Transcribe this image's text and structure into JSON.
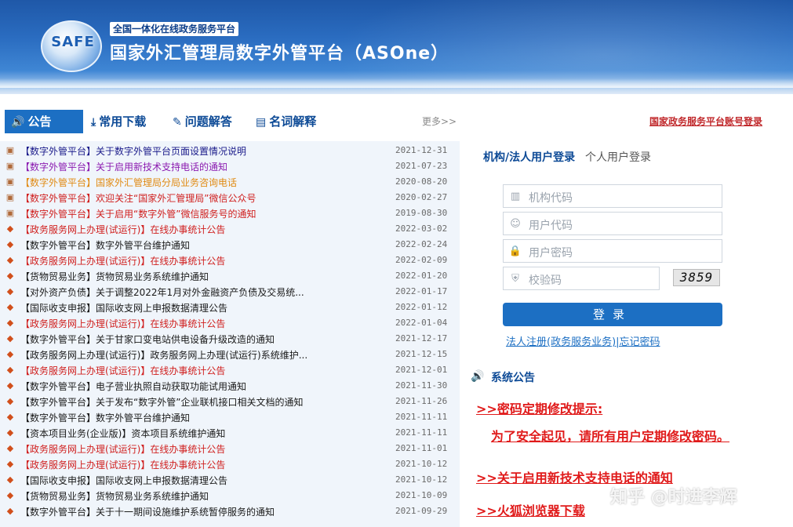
{
  "header": {
    "slogan": "全国一体化在线政务服务平台",
    "logo_text": "SAFE",
    "title": "国家外汇管理局数字外管平台（ASOne）"
  },
  "tabs": {
    "active": "公告",
    "items": [
      "常用下载",
      "问题解答",
      "名词解释"
    ],
    "more": "更多>>",
    "gov_login": "国家政务服务平台账号登录"
  },
  "notices": [
    {
      "tag": "【数字外管平台】",
      "title": "关于数字外管平台页面设置情况说明",
      "date": "2021-12-31",
      "color": "#1a1a8a",
      "icon": "doc-icon"
    },
    {
      "tag": "【数字外管平台】",
      "title": "关于启用新技术支持电话的通知",
      "date": "2021-07-23",
      "color": "#8b1bb0",
      "icon": "doc-icon"
    },
    {
      "tag": "【数字外管平台】",
      "title": "国家外汇管理局分局业务咨询电话",
      "date": "2020-08-20",
      "color": "#e08a12",
      "icon": "doc-icon"
    },
    {
      "tag": "【数字外管平台】",
      "title": "欢迎关注“国家外汇管理局”微信公众号",
      "date": "2020-02-27",
      "color": "#d0201f",
      "icon": "doc-icon"
    },
    {
      "tag": "【数字外管平台】",
      "title": "关于启用“数字外管”微信服务号的通知",
      "date": "2019-08-30",
      "color": "#d0201f",
      "icon": "doc-icon"
    },
    {
      "tag": "【政务服务网上办理(试运行)】",
      "title": "在线办事统计公告",
      "date": "2022-03-02",
      "color": "#d0201f",
      "icon": "diamond-icon"
    },
    {
      "tag": "【数字外管平台】",
      "title": "数字外管平台维护通知",
      "date": "2022-02-24",
      "color": "#1a1a1a",
      "icon": "diamond-icon"
    },
    {
      "tag": "【政务服务网上办理(试运行)】",
      "title": "在线办事统计公告",
      "date": "2022-02-09",
      "color": "#d0201f",
      "icon": "diamond-icon"
    },
    {
      "tag": "【货物贸易业务】",
      "title": "货物贸易业务系统维护通知",
      "date": "2022-01-20",
      "color": "#1a1a1a",
      "icon": "diamond-icon"
    },
    {
      "tag": "【对外资产负债】",
      "title": "关于调整2022年1月对外金融资产负债及交易统...",
      "date": "2022-01-17",
      "color": "#1a1a1a",
      "icon": "diamond-icon"
    },
    {
      "tag": "【国际收支申报】",
      "title": "国际收支网上申报数据清理公告",
      "date": "2022-01-12",
      "color": "#1a1a1a",
      "icon": "diamond-icon"
    },
    {
      "tag": "【政务服务网上办理(试运行)】",
      "title": "在线办事统计公告",
      "date": "2022-01-04",
      "color": "#d0201f",
      "icon": "diamond-icon"
    },
    {
      "tag": "【数字外管平台】",
      "title": "关于甘家口变电站供电设备升级改造的通知",
      "date": "2021-12-17",
      "color": "#1a1a1a",
      "icon": "diamond-icon"
    },
    {
      "tag": "【政务服务网上办理(试运行)】",
      "title": "政务服务网上办理(试运行)系统维护...",
      "date": "2021-12-15",
      "color": "#1a1a1a",
      "icon": "diamond-icon"
    },
    {
      "tag": "【政务服务网上办理(试运行)】",
      "title": "在线办事统计公告",
      "date": "2021-12-01",
      "color": "#d0201f",
      "icon": "diamond-icon"
    },
    {
      "tag": "【数字外管平台】",
      "title": "电子营业执照自动获取功能试用通知",
      "date": "2021-11-30",
      "color": "#1a1a1a",
      "icon": "diamond-icon"
    },
    {
      "tag": "【数字外管平台】",
      "title": "关于发布“数字外管”企业联机接口相关文档的通知",
      "date": "2021-11-26",
      "color": "#1a1a1a",
      "icon": "diamond-icon"
    },
    {
      "tag": "【数字外管平台】",
      "title": "数字外管平台维护通知",
      "date": "2021-11-11",
      "color": "#1a1a1a",
      "icon": "diamond-icon"
    },
    {
      "tag": "【资本项目业务(企业版)】",
      "title": "资本项目系统维护通知",
      "date": "2021-11-11",
      "color": "#1a1a1a",
      "icon": "diamond-icon"
    },
    {
      "tag": "【政务服务网上办理(试运行)】",
      "title": "在线办事统计公告",
      "date": "2021-11-01",
      "color": "#d0201f",
      "icon": "diamond-icon"
    },
    {
      "tag": "【政务服务网上办理(试运行)】",
      "title": "在线办事统计公告",
      "date": "2021-10-12",
      "color": "#d0201f",
      "icon": "diamond-icon"
    },
    {
      "tag": "【国际收支申报】",
      "title": "国际收支网上申报数据清理公告",
      "date": "2021-10-12",
      "color": "#1a1a1a",
      "icon": "diamond-icon"
    },
    {
      "tag": "【货物贸易业务】",
      "title": "货物贸易业务系统维护通知",
      "date": "2021-10-09",
      "color": "#1a1a1a",
      "icon": "diamond-icon"
    },
    {
      "tag": "【数字外管平台】",
      "title": "关于十一期间设施维护系统暂停服务的通知",
      "date": "2021-09-29",
      "color": "#1a1a1a",
      "icon": "diamond-icon"
    }
  ],
  "login": {
    "tab_org": "机构/法人用户登录",
    "tab_person": "个人用户登录",
    "org_code": "机构代码",
    "user_code": "用户代码",
    "password": "用户密码",
    "captcha_label": "校验码",
    "captcha_value": "3859",
    "button": "登录",
    "register": "法人注册(政务服务业务)|忘记密码"
  },
  "system_notice": {
    "title": "系统公告",
    "lines": [
      ">>密码定期修改提示:",
      "为了安全起见，请所有用户定期修改密码。",
      ">>关于启用新技术支持电话的通知",
      ">>火狐浏览器下载"
    ]
  },
  "watermark": "知乎 @时进李辉"
}
